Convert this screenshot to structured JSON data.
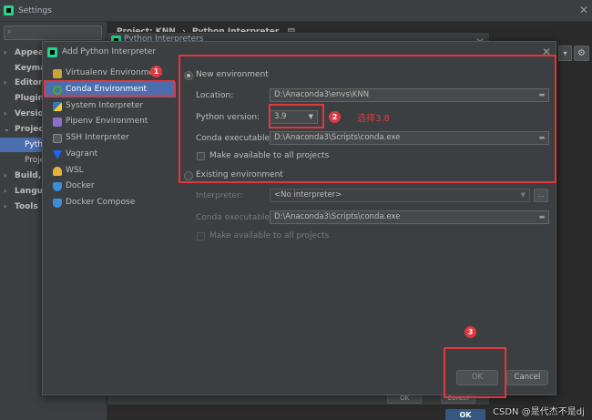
{
  "settings": {
    "title": "Settings",
    "header_project": "Project: KNN",
    "header_sep": "›",
    "header_page": "Python Interpreter",
    "header_icon": "table-icon",
    "sidebar": [
      {
        "label": "Appear",
        "arrow": "›"
      },
      {
        "label": "Keyma",
        "arrow": ""
      },
      {
        "label": "Editor",
        "arrow": "›"
      },
      {
        "label": "Plugin",
        "arrow": ""
      },
      {
        "label": "Versio",
        "arrow": "›"
      },
      {
        "label": "Project",
        "arrow": "⌄"
      },
      {
        "label": "Build, E",
        "arrow": "›"
      },
      {
        "label": "Langua",
        "arrow": "›"
      },
      {
        "label": "Tools",
        "arrow": "›"
      }
    ],
    "sidebar_sub": [
      {
        "label": "Pytho"
      },
      {
        "label": "Proje"
      }
    ],
    "ok_label": "OK"
  },
  "interpreters_dialog": {
    "title": "Python Interpreters",
    "ok_label": "OK",
    "cancel_label": "Cancel"
  },
  "dialog": {
    "title": "Add Python Interpreter",
    "env_types": [
      {
        "label": "Virtualenv Environment",
        "icon": "virtualenv-icon",
        "color": "#c9a43b"
      },
      {
        "label": "Conda Environment",
        "icon": "conda-icon",
        "color": "#44a833"
      },
      {
        "label": "System Interpreter",
        "icon": "python-icon",
        "color": "#3a76b8"
      },
      {
        "label": "Pipenv Environment",
        "icon": "pipenv-icon",
        "color": "#8b6fc9"
      },
      {
        "label": "SSH Interpreter",
        "icon": "ssh-icon",
        "color": "#8a8a8a"
      },
      {
        "label": "Vagrant",
        "icon": "vagrant-icon",
        "color": "#1868f2"
      },
      {
        "label": "WSL",
        "icon": "wsl-icon",
        "color": "#e0b43a"
      },
      {
        "label": "Docker",
        "icon": "docker-icon",
        "color": "#3a8fd8"
      },
      {
        "label": "Docker Compose",
        "icon": "docker-compose-icon",
        "color": "#3a8fd8"
      }
    ],
    "new_env_label": "New environment",
    "location_label": "Location:",
    "location_value": "D:\\Anaconda3\\envs\\KNN",
    "python_version_label": "Python version:",
    "python_version_value": "3.9",
    "conda_exe_label": "Conda executable:",
    "conda_exe_value": "D:\\Anaconda3\\Scripts\\conda.exe",
    "make_available_label": "Make available to all projects",
    "existing_env_label": "Existing environment",
    "interpreter_label": "Interpreter:",
    "interpreter_value": "<No interpreter>",
    "existing_conda_exe_label": "Conda executable:",
    "existing_conda_exe_value": "D:\\Anaconda3\\Scripts\\conda.exe",
    "existing_make_available_label": "Make available to all projects",
    "ok_label": "OK",
    "cancel_label": "Cancel",
    "ellipsis": "...",
    "caret": "▼",
    "close_glyph": "✕"
  },
  "annotations": {
    "num1": "1",
    "num2": "2",
    "num3": "3",
    "note2": "选择3.8",
    "color": "#e0383e"
  },
  "watermark": "CSDN @是代杰不是dj"
}
